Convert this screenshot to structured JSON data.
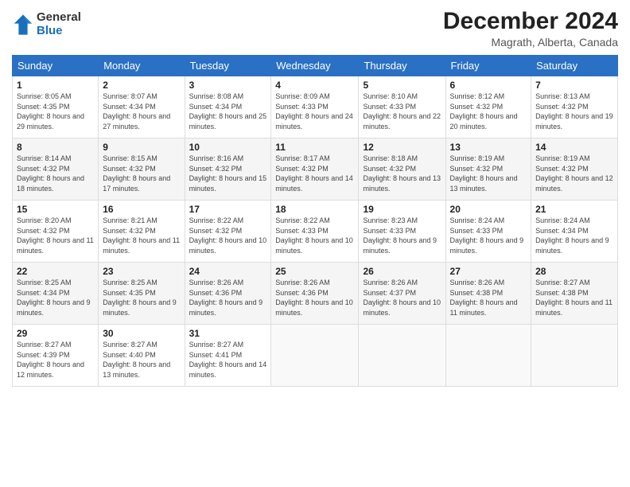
{
  "logo": {
    "general": "General",
    "blue": "Blue"
  },
  "title": "December 2024",
  "location": "Magrath, Alberta, Canada",
  "days_header": [
    "Sunday",
    "Monday",
    "Tuesday",
    "Wednesday",
    "Thursday",
    "Friday",
    "Saturday"
  ],
  "weeks": [
    [
      {
        "day": "1",
        "sunrise": "8:05 AM",
        "sunset": "4:35 PM",
        "daylight": "8 hours and 29 minutes."
      },
      {
        "day": "2",
        "sunrise": "8:07 AM",
        "sunset": "4:34 PM",
        "daylight": "8 hours and 27 minutes."
      },
      {
        "day": "3",
        "sunrise": "8:08 AM",
        "sunset": "4:34 PM",
        "daylight": "8 hours and 25 minutes."
      },
      {
        "day": "4",
        "sunrise": "8:09 AM",
        "sunset": "4:33 PM",
        "daylight": "8 hours and 24 minutes."
      },
      {
        "day": "5",
        "sunrise": "8:10 AM",
        "sunset": "4:33 PM",
        "daylight": "8 hours and 22 minutes."
      },
      {
        "day": "6",
        "sunrise": "8:12 AM",
        "sunset": "4:32 PM",
        "daylight": "8 hours and 20 minutes."
      },
      {
        "day": "7",
        "sunrise": "8:13 AM",
        "sunset": "4:32 PM",
        "daylight": "8 hours and 19 minutes."
      }
    ],
    [
      {
        "day": "8",
        "sunrise": "8:14 AM",
        "sunset": "4:32 PM",
        "daylight": "8 hours and 18 minutes."
      },
      {
        "day": "9",
        "sunrise": "8:15 AM",
        "sunset": "4:32 PM",
        "daylight": "8 hours and 17 minutes."
      },
      {
        "day": "10",
        "sunrise": "8:16 AM",
        "sunset": "4:32 PM",
        "daylight": "8 hours and 15 minutes."
      },
      {
        "day": "11",
        "sunrise": "8:17 AM",
        "sunset": "4:32 PM",
        "daylight": "8 hours and 14 minutes."
      },
      {
        "day": "12",
        "sunrise": "8:18 AM",
        "sunset": "4:32 PM",
        "daylight": "8 hours and 13 minutes."
      },
      {
        "day": "13",
        "sunrise": "8:19 AM",
        "sunset": "4:32 PM",
        "daylight": "8 hours and 13 minutes."
      },
      {
        "day": "14",
        "sunrise": "8:19 AM",
        "sunset": "4:32 PM",
        "daylight": "8 hours and 12 minutes."
      }
    ],
    [
      {
        "day": "15",
        "sunrise": "8:20 AM",
        "sunset": "4:32 PM",
        "daylight": "8 hours and 11 minutes."
      },
      {
        "day": "16",
        "sunrise": "8:21 AM",
        "sunset": "4:32 PM",
        "daylight": "8 hours and 11 minutes."
      },
      {
        "day": "17",
        "sunrise": "8:22 AM",
        "sunset": "4:32 PM",
        "daylight": "8 hours and 10 minutes."
      },
      {
        "day": "18",
        "sunrise": "8:22 AM",
        "sunset": "4:33 PM",
        "daylight": "8 hours and 10 minutes."
      },
      {
        "day": "19",
        "sunrise": "8:23 AM",
        "sunset": "4:33 PM",
        "daylight": "8 hours and 9 minutes."
      },
      {
        "day": "20",
        "sunrise": "8:24 AM",
        "sunset": "4:33 PM",
        "daylight": "8 hours and 9 minutes."
      },
      {
        "day": "21",
        "sunrise": "8:24 AM",
        "sunset": "4:34 PM",
        "daylight": "8 hours and 9 minutes."
      }
    ],
    [
      {
        "day": "22",
        "sunrise": "8:25 AM",
        "sunset": "4:34 PM",
        "daylight": "8 hours and 9 minutes."
      },
      {
        "day": "23",
        "sunrise": "8:25 AM",
        "sunset": "4:35 PM",
        "daylight": "8 hours and 9 minutes."
      },
      {
        "day": "24",
        "sunrise": "8:26 AM",
        "sunset": "4:36 PM",
        "daylight": "8 hours and 9 minutes."
      },
      {
        "day": "25",
        "sunrise": "8:26 AM",
        "sunset": "4:36 PM",
        "daylight": "8 hours and 10 minutes."
      },
      {
        "day": "26",
        "sunrise": "8:26 AM",
        "sunset": "4:37 PM",
        "daylight": "8 hours and 10 minutes."
      },
      {
        "day": "27",
        "sunrise": "8:26 AM",
        "sunset": "4:38 PM",
        "daylight": "8 hours and 11 minutes."
      },
      {
        "day": "28",
        "sunrise": "8:27 AM",
        "sunset": "4:38 PM",
        "daylight": "8 hours and 11 minutes."
      }
    ],
    [
      {
        "day": "29",
        "sunrise": "8:27 AM",
        "sunset": "4:39 PM",
        "daylight": "8 hours and 12 minutes."
      },
      {
        "day": "30",
        "sunrise": "8:27 AM",
        "sunset": "4:40 PM",
        "daylight": "8 hours and 13 minutes."
      },
      {
        "day": "31",
        "sunrise": "8:27 AM",
        "sunset": "4:41 PM",
        "daylight": "8 hours and 14 minutes."
      },
      null,
      null,
      null,
      null
    ]
  ],
  "labels": {
    "sunrise": "Sunrise:",
    "sunset": "Sunset:",
    "daylight": "Daylight:"
  }
}
